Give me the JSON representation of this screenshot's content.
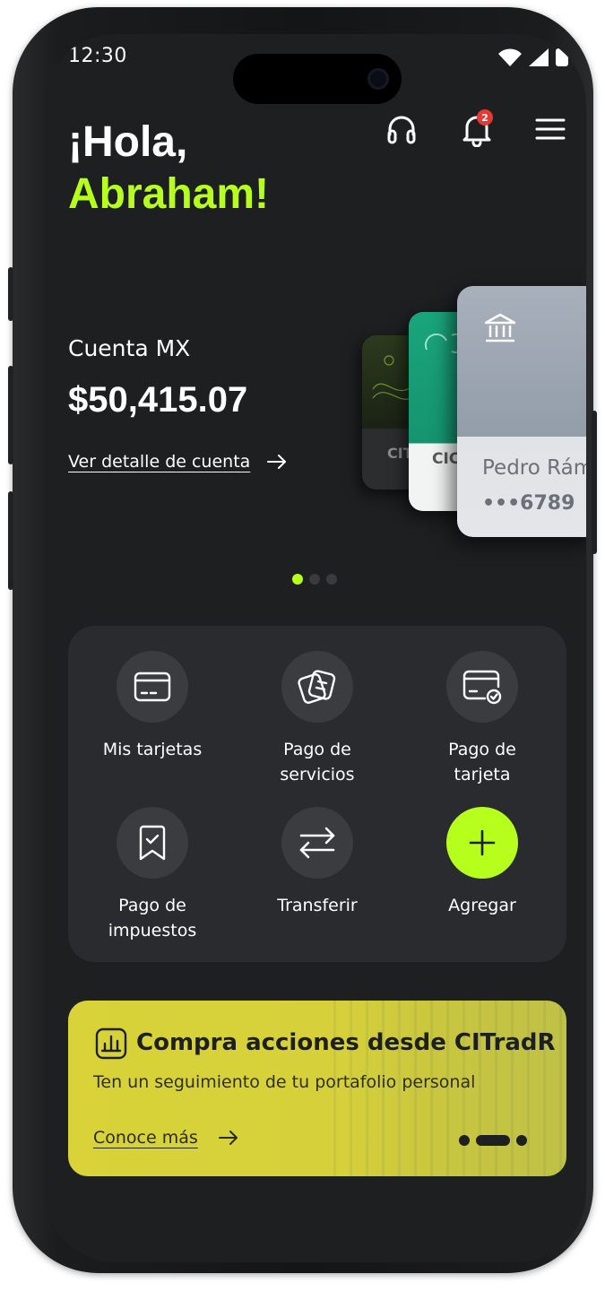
{
  "status_bar": {
    "time": "12:30"
  },
  "header": {
    "greeting_line1": "¡Hola,",
    "greeting_line2": "Abraham!",
    "support_icon": "headset-icon",
    "notifications_icon": "bell-icon",
    "notifications_count": "2",
    "menu_icon": "hamburger-menu-icon"
  },
  "account": {
    "name": "Cuenta MX",
    "balance": "$50,415.07",
    "detail_link": "Ver detalle de cuenta"
  },
  "cards": [
    {
      "label": "CIT",
      "color": "#2c3a1d"
    },
    {
      "label": "CIC",
      "color": "#1aa57c"
    },
    {
      "holder": "Pedro Rám",
      "digits": "•••6789",
      "icon": "bank-icon",
      "color": "#a7b0bb"
    }
  ],
  "carousel": {
    "pages": 3,
    "active": 0
  },
  "quick_actions": [
    {
      "label": "Mis tarjetas",
      "icon": "card-icon"
    },
    {
      "label": "Pago de servicios",
      "icon": "receipts-icon"
    },
    {
      "label": "Pago de tarjeta",
      "icon": "card-check-icon"
    },
    {
      "label": "Pago de impuestos",
      "icon": "bookmark-check-icon"
    },
    {
      "label": "Transferir",
      "icon": "transfer-arrows-icon"
    },
    {
      "label": "Agregar",
      "icon": "plus-icon"
    }
  ],
  "promo": {
    "title": "Compra acciones desde CITradR",
    "subtitle": "Ten un seguimiento de tu portafolio personal",
    "link": "Conoce más",
    "icon": "bar-chart-icon",
    "pages": 3,
    "active": 1
  },
  "colors": {
    "accent": "#b6ff1d",
    "background": "#1e1f21",
    "panel": "#2a2b2e",
    "promo": "#d6d03a",
    "badge": "#e53935"
  }
}
